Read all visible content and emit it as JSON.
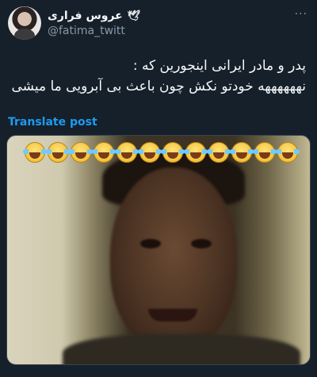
{
  "user": {
    "display_name": "عروس فراری",
    "name_emoji": "🕊",
    "handle": "@fatima_twitt"
  },
  "post": {
    "lines": [
      "پدر و مادر ایرانی اینجورین که :",
      "نههههههه خودتو نکش چون باعث بی آبرویی ما میشی"
    ],
    "translate_label": "Translate post",
    "more_label": "···"
  },
  "media": {
    "emoji_count": 12,
    "emoji_icon": "laughing-crying-emoji-icon"
  },
  "colors": {
    "background": "#15202b",
    "text": "#f7f9f9",
    "secondary": "#8b98a5",
    "link": "#1d9bf0"
  }
}
